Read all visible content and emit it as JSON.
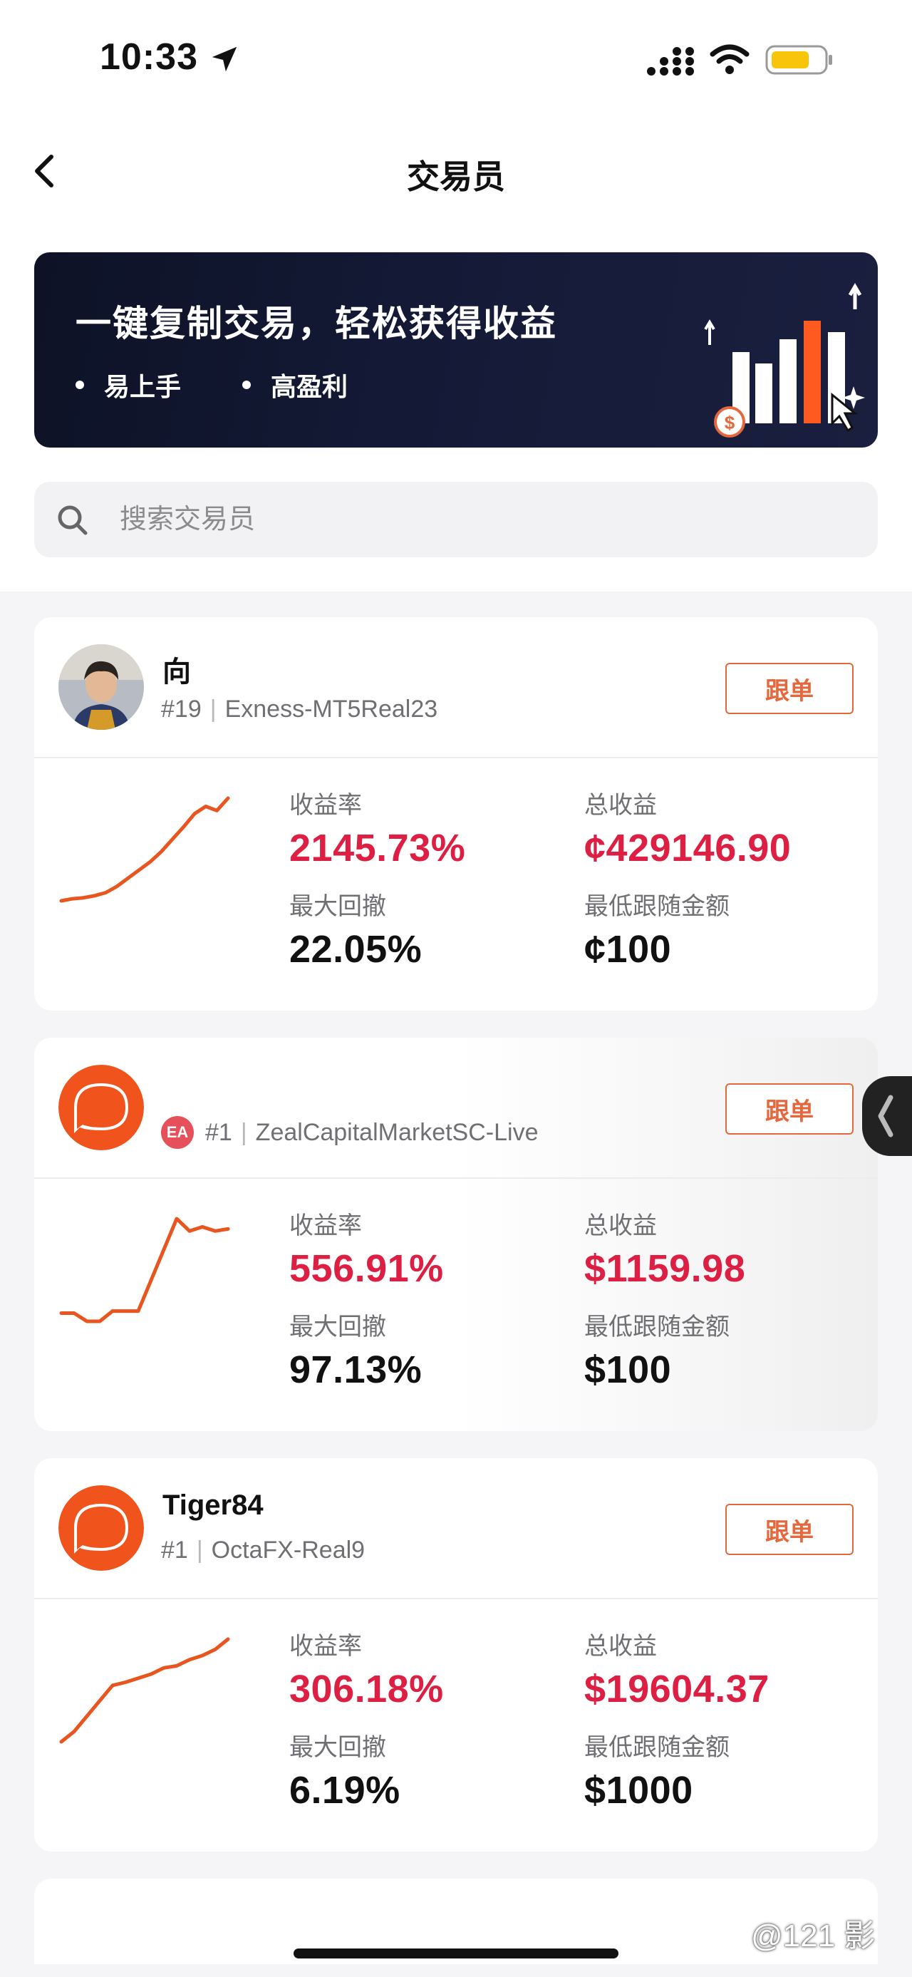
{
  "status_bar": {
    "time": "10:33"
  },
  "header": {
    "title": "交易员"
  },
  "banner": {
    "title": "一键复制交易，轻松获得收益",
    "bullets": [
      "易上手",
      "高盈利"
    ]
  },
  "search": {
    "placeholder": "搜索交易员"
  },
  "labels": {
    "return_rate": "收益率",
    "total_profit": "总收益",
    "max_drawdown": "最大回撤",
    "min_follow": "最低跟随金额",
    "follow": "跟单"
  },
  "traders": [
    {
      "name": "向",
      "rank": "#19",
      "server": "Exness-MT5Real23",
      "return_rate": "2145.73%",
      "total_profit": "¢429146.90",
      "max_drawdown": "22.05%",
      "min_follow": "¢100",
      "sparkline": [
        0,
        2,
        3,
        5,
        8,
        14,
        22,
        30,
        38,
        48,
        60,
        72,
        85,
        92,
        88,
        100
      ]
    },
    {
      "name": "",
      "badge": "EA",
      "rank": "#1",
      "server": "ZealCapitalMarketSC-Live",
      "return_rate": "556.91%",
      "total_profit": "$1159.98",
      "max_drawdown": "97.13%",
      "min_follow": "$100",
      "sparkline": [
        8,
        8,
        0,
        0,
        10,
        10,
        10,
        40,
        70,
        100,
        88,
        92,
        88,
        90
      ]
    },
    {
      "name": "Tiger84",
      "rank": "#1",
      "server": "OctaFX-Real9",
      "return_rate": "306.18%",
      "total_profit": "$19604.37",
      "max_drawdown": "6.19%",
      "min_follow": "$1000",
      "sparkline": [
        0,
        10,
        25,
        40,
        55,
        58,
        62,
        66,
        72,
        74,
        80,
        84,
        90,
        100
      ]
    }
  ],
  "watermark": "@121 影",
  "colors": {
    "accent": "#e5673c",
    "profit_red": "#dc1f43",
    "banner_bg": "#0d1226",
    "sparkline": "#e8551f"
  }
}
